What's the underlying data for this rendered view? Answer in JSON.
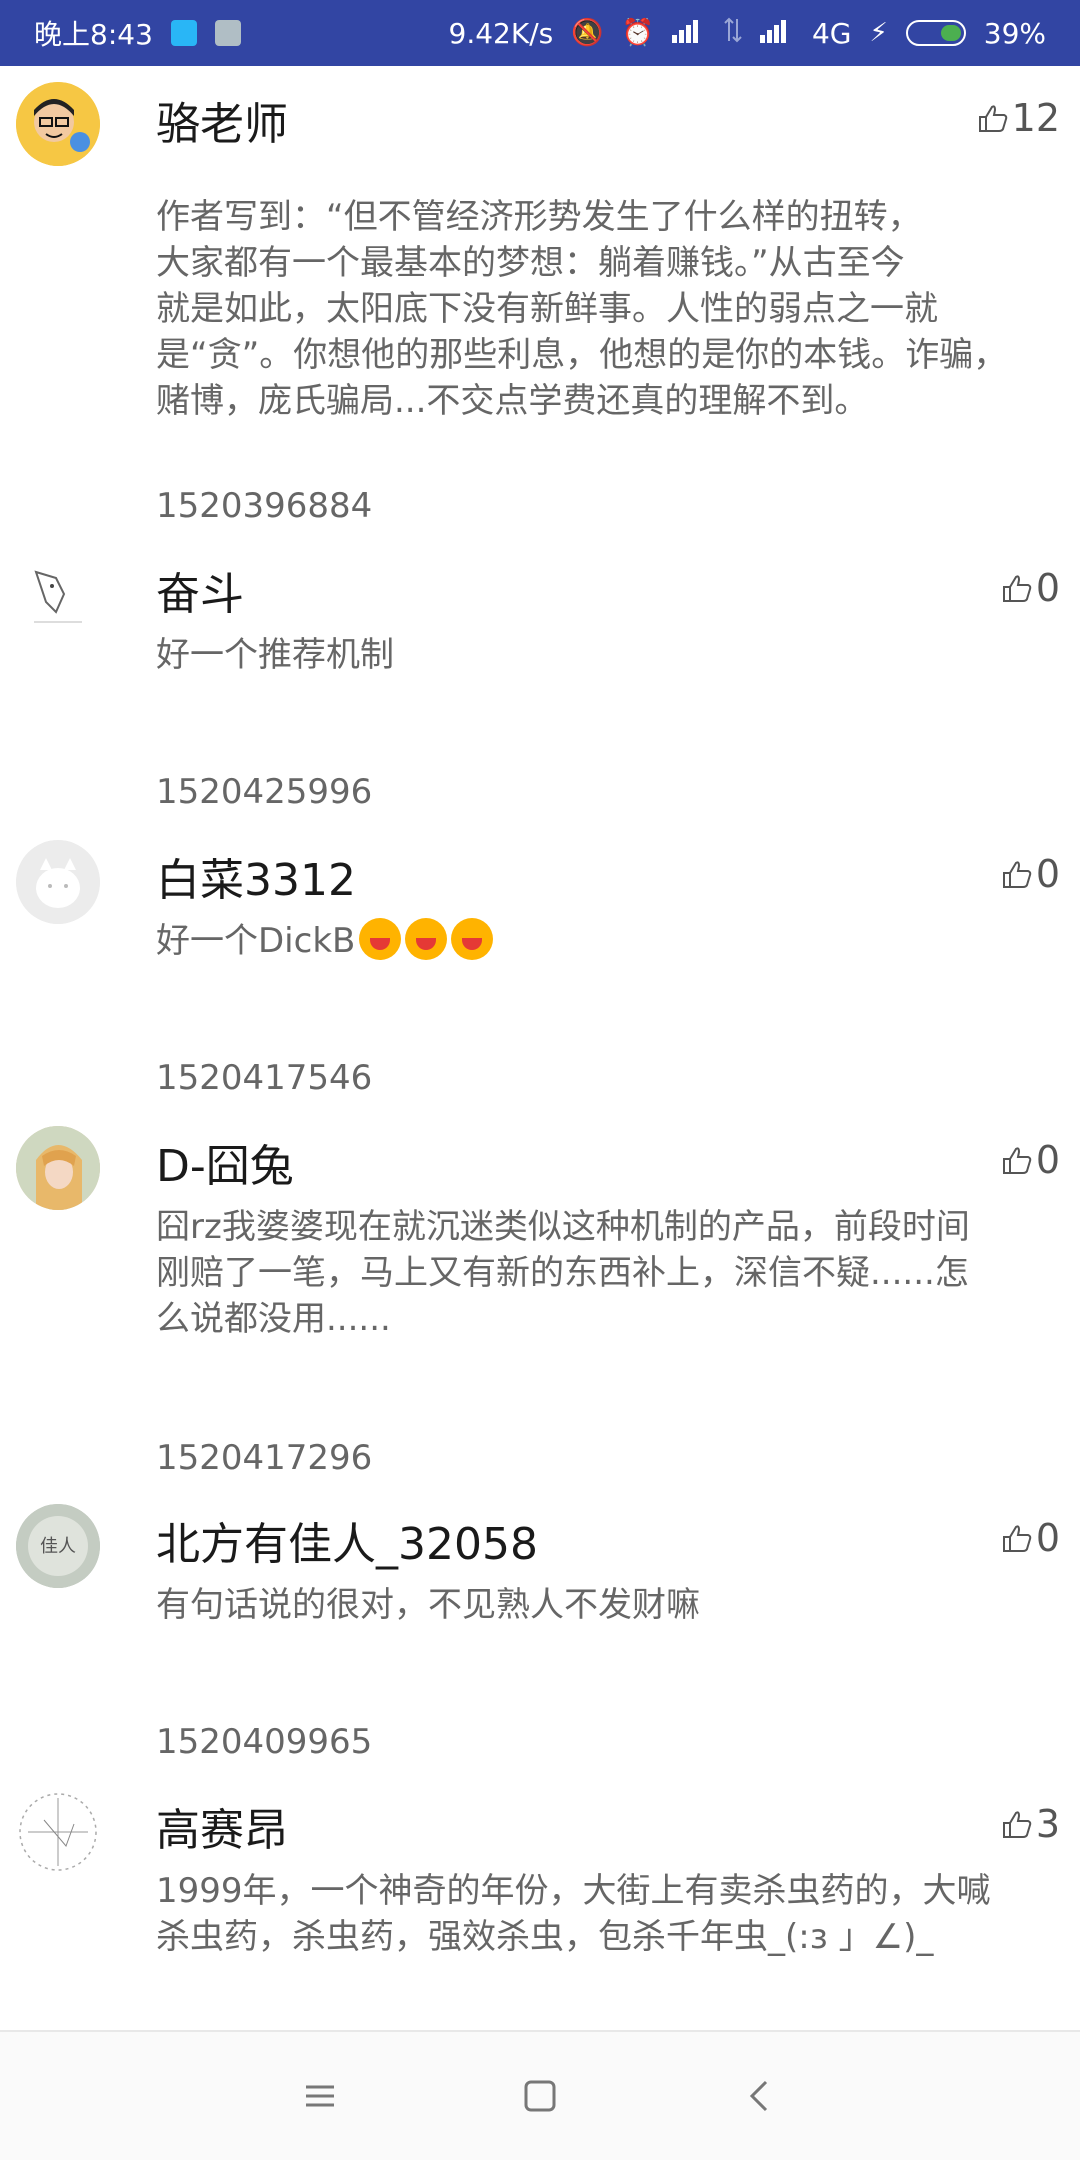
{
  "status_bar": {
    "time": "晚上8:43",
    "net_speed": "9.42K/s",
    "network": "4G",
    "battery": "39%",
    "icons": [
      "notification-app-icon",
      "notification-news-icon",
      "mute-icon",
      "alarm-icon",
      "signal-icon",
      "data-arrows-icon",
      "signal-icon",
      "charging-icon",
      "battery-icon"
    ]
  },
  "comments": [
    {
      "name": "骆老师",
      "likes": "12",
      "text": "作者写到：“但不管经济形势发生了什么样的扭转，\n大家都有一个最基本的梦想：躺着赚钱。”从古至今\n就是如此，太阳底下没有新鲜事。人性的弱点之一就\n是“贪”。你想他的那些利息，他想的是你的本钱。诈骗，\n赌博，庞氏骗局...不交点学费还真的理解不到。",
      "timestamp": "1520396884"
    },
    {
      "name": "奋斗",
      "likes": "0",
      "text": "好一个推荐机制",
      "timestamp": "1520425996"
    },
    {
      "name": "白菜3312",
      "likes": "0",
      "text": "好一个DickB",
      "emoji_count": 3,
      "timestamp": "1520417546"
    },
    {
      "name": "D-囧兔",
      "likes": "0",
      "text": "囧rz我婆婆现在就沉迷类似这种机制的产品，前段时间\n刚赔了一笔，马上又有新的东西补上，深信不疑......怎\n么说都没用......",
      "timestamp": "1520417296"
    },
    {
      "name": "北方有佳人_32058",
      "likes": "0",
      "text": "有句话说的很对，不见熟人不发财嘛",
      "timestamp": "1520409965"
    },
    {
      "name": "高赛昂",
      "likes": "3",
      "text": "1999年，一个神奇的年份，大街上有卖杀虫药的，大喊\n杀虫药，杀虫药，强效杀虫，包杀千年虫_(:з 」∠)_"
    }
  ],
  "nav_bar": {
    "icons": [
      "menu-icon",
      "home-icon",
      "back-icon"
    ]
  }
}
